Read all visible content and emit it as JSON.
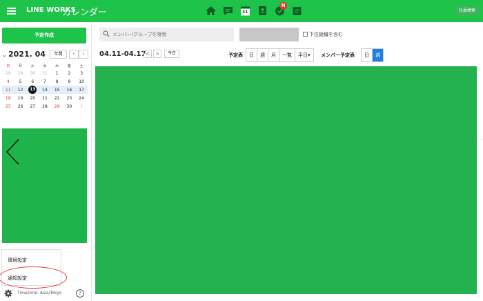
{
  "header": {
    "brand": "LINE WORKS",
    "app_name": "カレンダー",
    "nav_icons": [
      "home-icon",
      "chat-icon",
      "calendar-icon",
      "contacts-icon",
      "task-icon",
      "board-icon"
    ],
    "calendar_icon_day": "31",
    "notification_badge": "N",
    "directory_search": "社員検索"
  },
  "sidebar": {
    "create_button": "予定作成",
    "mini_calendar": {
      "title": "2021. 04",
      "year_button": "年間",
      "weekdays": [
        "日",
        "月",
        "火",
        "水",
        "木",
        "金",
        "土"
      ],
      "weeks": [
        [
          "28",
          "29",
          "30",
          "31",
          "1",
          "2",
          "3"
        ],
        [
          "4",
          "5",
          "6",
          "7",
          "8",
          "9",
          "10"
        ],
        [
          "11",
          "12",
          "13",
          "14",
          "15",
          "16",
          "17"
        ],
        [
          "18",
          "19",
          "20",
          "21",
          "22",
          "23",
          "24"
        ],
        [
          "25",
          "26",
          "27",
          "28",
          "29",
          "30",
          "1"
        ]
      ]
    },
    "settings_menu": {
      "environment": "環境設定",
      "notifications": "通知設定"
    },
    "timezone": "Timezone: Asia/Tokyo",
    "help": "?"
  },
  "toolbar": {
    "search_placeholder": "メンバー/グループを検索",
    "include_sub_org": "下位組織を含む",
    "date_range": "04.11-04.17",
    "prev": "<",
    "next": ">",
    "today": "今日",
    "schedule_label": "予定表",
    "views": [
      "日",
      "週",
      "月",
      "一覧",
      "平日▾"
    ],
    "member_schedule_label": "メンバー予定表",
    "member_views": [
      "日",
      "週"
    ]
  },
  "colors": {
    "header_green": "#1ec34a",
    "panel_green": "#23b24e",
    "active_blue": "#1a7fe8",
    "highlight_red": "#e23a3a"
  }
}
